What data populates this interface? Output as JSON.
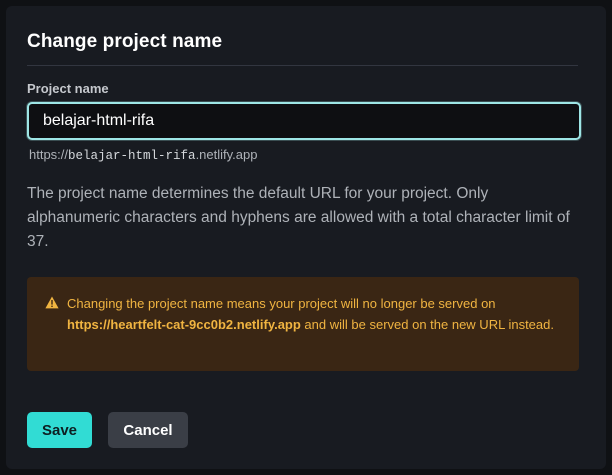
{
  "dialog": {
    "title": "Change project name",
    "field_label": "Project name",
    "input_value": "belajar-html-rifa",
    "url_prefix": "https://",
    "url_slug": "belajar-html-rifa",
    "url_suffix": ".netlify.app",
    "description": "The project name determines the default URL for your project. Only alphanumeric characters and hyphens are allowed with a total character limit of 37.",
    "warning": {
      "icon": "warning-triangle-icon",
      "text_before": "Changing the project name means your project will no longer be served on ",
      "old_url": "https://heartfelt-cat-9cc0b2.netlify.app",
      "text_after": " and will be served on the new URL instead."
    },
    "save_label": "Save",
    "cancel_label": "Cancel"
  },
  "colors": {
    "accent": "#31dcd4",
    "input_focus_border": "#9ee6e6",
    "warning_bg": "#3a2614",
    "warning_text": "#f0b441"
  }
}
